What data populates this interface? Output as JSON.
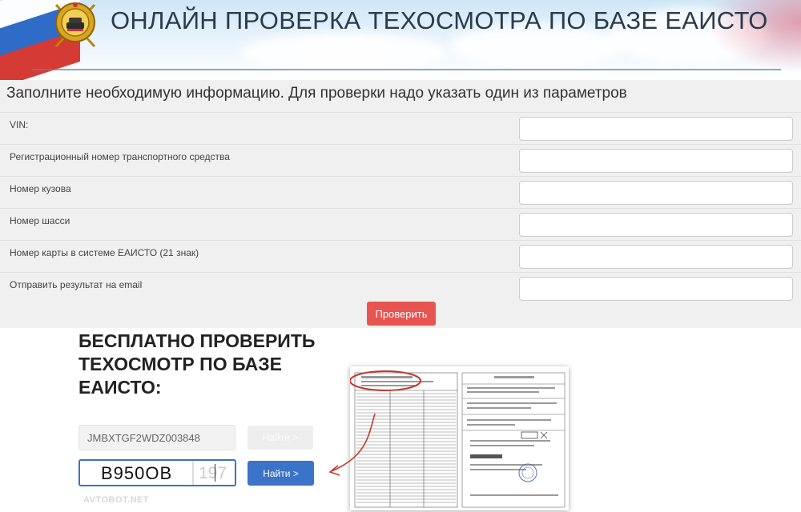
{
  "header": {
    "title": "ОНЛАЙН ПРОВЕРКА ТЕХОСМОТРА ПО БАЗЕ ЕАИСТО",
    "emblem_icon": "traffic-police-emblem-icon"
  },
  "form": {
    "heading": "Заполните необходимую информацию. Для проверки надо указать один из параметров",
    "fields": [
      {
        "label": "VIN:",
        "value": ""
      },
      {
        "label": "Регистрационный номер транспортного средства",
        "value": ""
      },
      {
        "label": "Номер кузова",
        "value": ""
      },
      {
        "label": "Номер шасси",
        "value": ""
      },
      {
        "label": "Номер карты в системе ЕАИСТО (21 знак)",
        "value": ""
      },
      {
        "label": "Отправить результат на email",
        "value": ""
      }
    ],
    "submit_label": "Проверить",
    "submit_color": "#e85450"
  },
  "promo": {
    "title_lines": [
      "БЕСПЛАТНО ПРОВЕРИТЬ",
      "ТЕХОСМОТР ПО БАЗЕ",
      "ЕАИСТО:"
    ],
    "vin_value": "JMBXTGF2WDZ003848",
    "find_disabled_label": "Найти >",
    "plate_number": "В950ОВ",
    "plate_region": "197",
    "find_label": "Найти >",
    "find_color": "#3a73c8",
    "watermark": "AVTOBOT.NET",
    "document_icon": "diagnostic-card-document-icon",
    "arrow_icon": "curved-arrow-icon"
  }
}
